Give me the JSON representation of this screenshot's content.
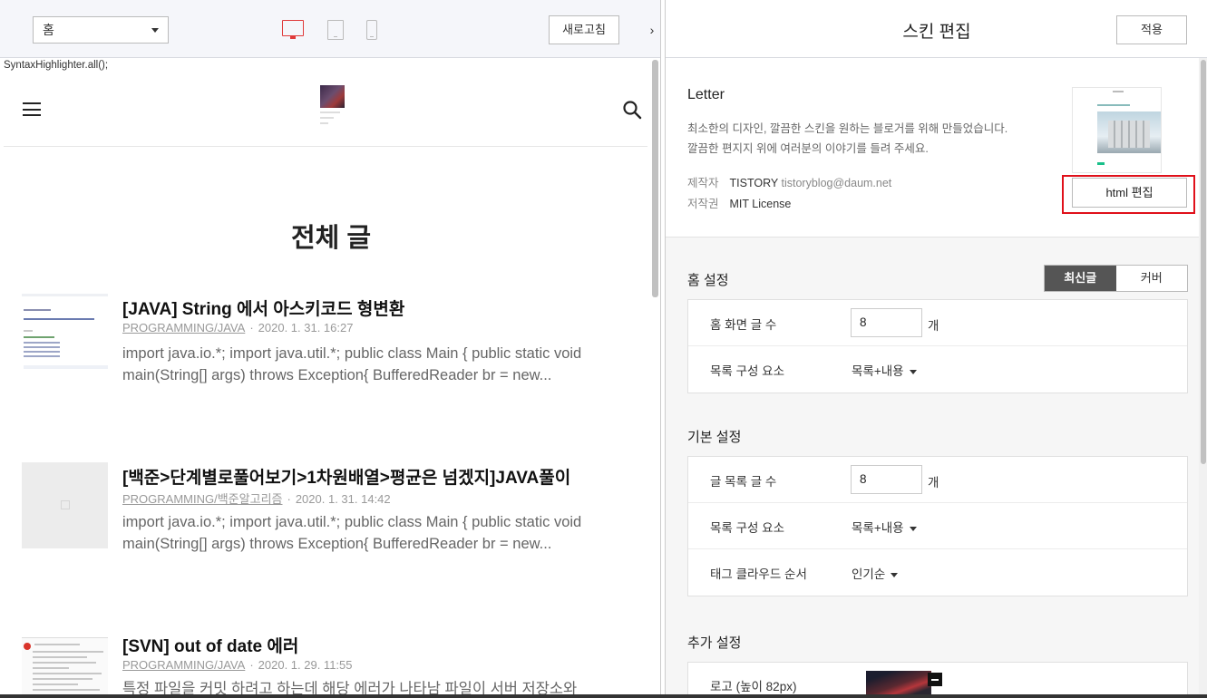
{
  "left": {
    "page_select": "홈",
    "refresh_label": "새로고침",
    "collapse_arrow": "›"
  },
  "preview": {
    "syntax_text": "SyntaxHighlighter.all();",
    "section_title": "전체 글",
    "posts": [
      {
        "title": "[JAVA] String 에서 아스키코드 형변환",
        "category": "PROGRAMMING/JAVA",
        "date": "2020. 1. 31. 16:27",
        "excerpt": "import java.io.*; import java.util.*; public class Main { public static void main(String[] args) throws Exception{ BufferedReader br = new..."
      },
      {
        "title": "[백준>단계별로풀어보기>1차원배열>평균은 넘겠지]JAVA풀이",
        "category": "PROGRAMMING/백준알고리즘",
        "date": "2020. 1. 31. 14:42",
        "excerpt": "import java.io.*; import java.util.*; public class Main { public static void main(String[] args) throws Exception{ BufferedReader br = new..."
      },
      {
        "title": "[SVN] out of date 에러",
        "category": "PROGRAMMING/JAVA",
        "date": "2020. 1. 29. 11:55",
        "excerpt": "특정 파일을 커밋 하려고 하는데 해당 에러가 나타남 파일이 서버 저장소와"
      }
    ]
  },
  "right": {
    "title": "스킨 편집",
    "apply_label": "적용",
    "skin": {
      "name": "Letter",
      "desc_line1": "최소한의 디자인, 깔끔한 스킨을 원하는 블로거를 위해 만들었습니다.",
      "desc_line2": "깔끔한 편지지 위에 여러분의 이야기를 들려 주세요.",
      "author_label": "제작자",
      "author_name": "TISTORY",
      "author_email": "tistoryblog@daum.net",
      "license_label": "저작권",
      "license_value": "MIT License",
      "html_edit_label": "html 편집"
    },
    "home_settings": {
      "title": "홈 설정",
      "toggle_on": "최신글",
      "toggle_off": "커버",
      "post_count_label": "홈 화면 글 수",
      "post_count_value": "8",
      "unit": "개",
      "list_label": "목록 구성 요소",
      "list_value": "목록+내용"
    },
    "basic_settings": {
      "title": "기본 설정",
      "post_count_label": "글 목록 글 수",
      "post_count_value": "8",
      "unit": "개",
      "list_label": "목록 구성 요소",
      "list_value": "목록+내용",
      "tag_label": "태그 클라우드 순서",
      "tag_value": "인기순"
    },
    "extra_settings": {
      "title": "추가 설정",
      "logo_label": "로고 (높이 82px)"
    }
  },
  "colors": {
    "accent_red": "#e03a3a",
    "highlight_box": "#e0101a",
    "toggle_active": "#555555",
    "skin_tag": "#19c08a"
  },
  "icons": [
    "chevron-down-icon",
    "desktop-icon",
    "tablet-icon",
    "mobile-icon",
    "chevron-right-icon",
    "hamburger-icon",
    "search-icon",
    "minus-icon"
  ]
}
